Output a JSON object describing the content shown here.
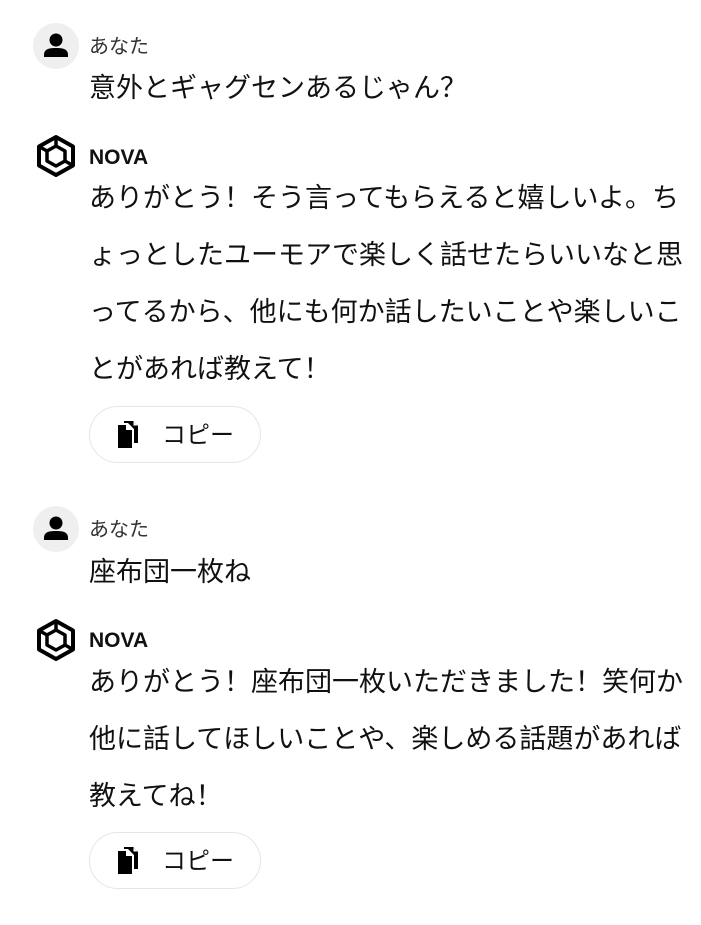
{
  "conversation": [
    {
      "role": "user",
      "sender": "あなた",
      "text": "意外とギャグセンあるじゃん？"
    },
    {
      "role": "assistant",
      "sender": "NOVA",
      "text": "ありがとう！そう言ってもらえると嬉しいよ。ちょっとしたユーモアで楽しく話せたらいいなと思ってるから、他にも何か話したいことや楽しいことがあれば教えて！",
      "copy_label": "コピー"
    },
    {
      "role": "user",
      "sender": "あなた",
      "text": "座布団一枚ね"
    },
    {
      "role": "assistant",
      "sender": "NOVA",
      "text": "ありがとう！座布団一枚いただきました！笑何か他に話してほしいことや、楽しめる話題があれば教えてね！",
      "copy_label": "コピー"
    }
  ],
  "icons": {
    "user_avatar": "person-icon",
    "bot_avatar": "nova-logo-icon",
    "copy": "copy-icon"
  },
  "colors": {
    "user_avatar_bg": "#efefef",
    "text": "#111111",
    "copy_border": "#e6e6e6"
  }
}
